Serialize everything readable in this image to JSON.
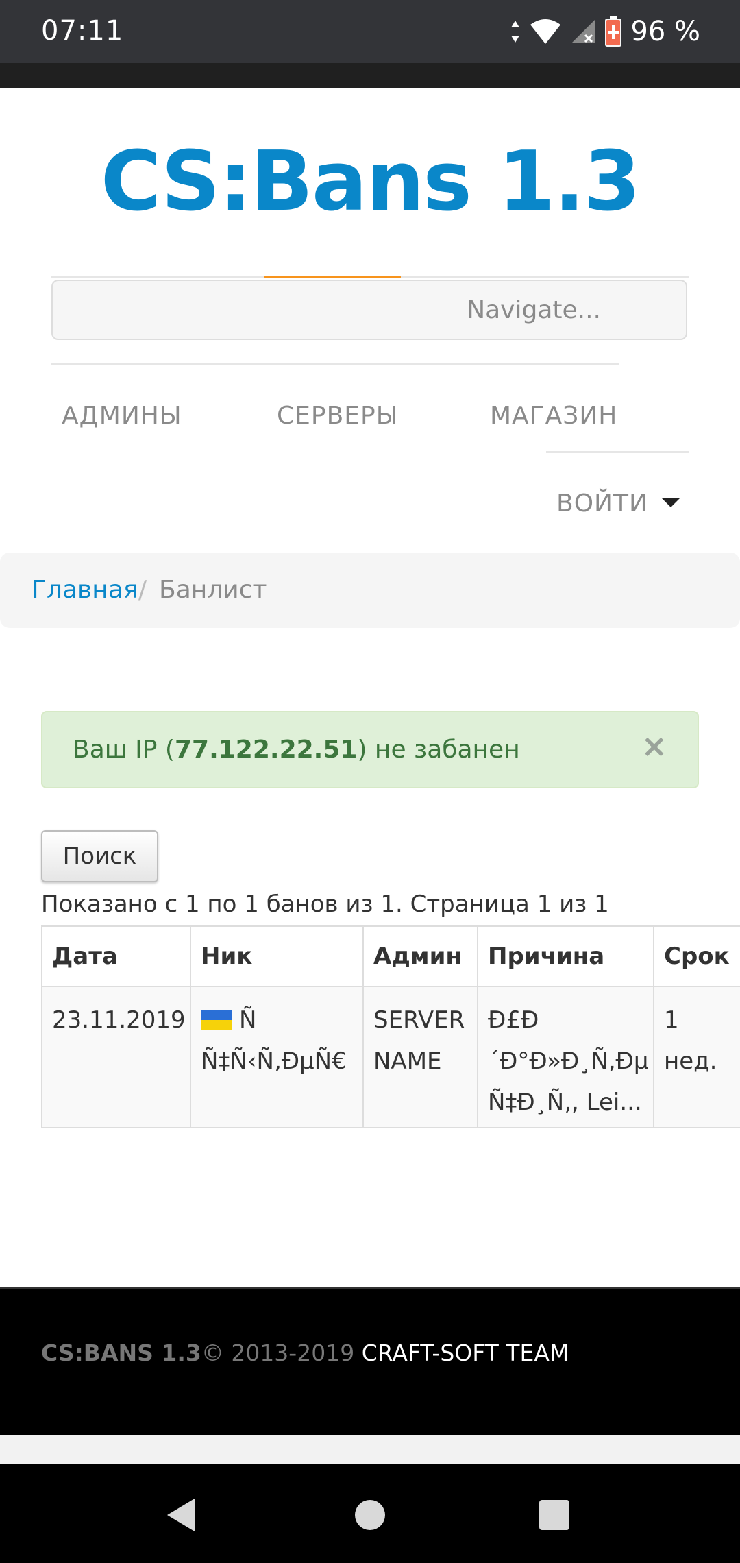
{
  "status_bar": {
    "time": "07:11",
    "battery_percent": "96 %",
    "icons": [
      "data-arrows-icon",
      "wifi-icon",
      "signal-icon",
      "battery-icon"
    ]
  },
  "header": {
    "site_title": "CS:Bans 1.3",
    "navigate_placeholder": "Navigate...",
    "nav_links": [
      "АДМИНЫ",
      "СЕРВЕРЫ",
      "МАГАЗИН"
    ],
    "login_label": "ВОЙТИ"
  },
  "breadcrumb": {
    "home": "Главная",
    "separator": "/",
    "current": "Банлист"
  },
  "alert": {
    "prefix": "Ваш IP (",
    "ip": "77.122.22.51",
    "suffix": ") не забанен",
    "close": "×"
  },
  "search_button": "Поиск",
  "summary": "Показано с 1 по 1 банов из 1. Страница 1 из 1",
  "table": {
    "headers": [
      "Дата",
      "Ник",
      "Админ",
      "Причина",
      "Срок"
    ],
    "rows": [
      {
        "date": "23.11.2019",
        "nick_line1": "Ñ",
        "nick_line2": "Ñ‡Ñ‹Ñ‚ÐµÑ€",
        "admin_line1": "SERVER",
        "admin_line2": "NAME",
        "reason_line1": "Ð£Ð",
        "reason_line2": "´Ð°Ð»Ð¸Ñ‚Ðµ",
        "reason_line3": "Ñ‡Ð¸Ñ‚, Lei...",
        "term_line1": "1",
        "term_line2": "нед."
      }
    ]
  },
  "footer": {
    "brand": "CS:BANS 1.3",
    "copyright": "© 2013-2019 ",
    "team": "CRAFT-SOFT TEAM"
  },
  "colors": {
    "brand_blue": "#0a87c9",
    "accent_orange": "#f7941d",
    "alert_green_bg": "#dff0d8",
    "alert_green_text": "#3c763d"
  }
}
